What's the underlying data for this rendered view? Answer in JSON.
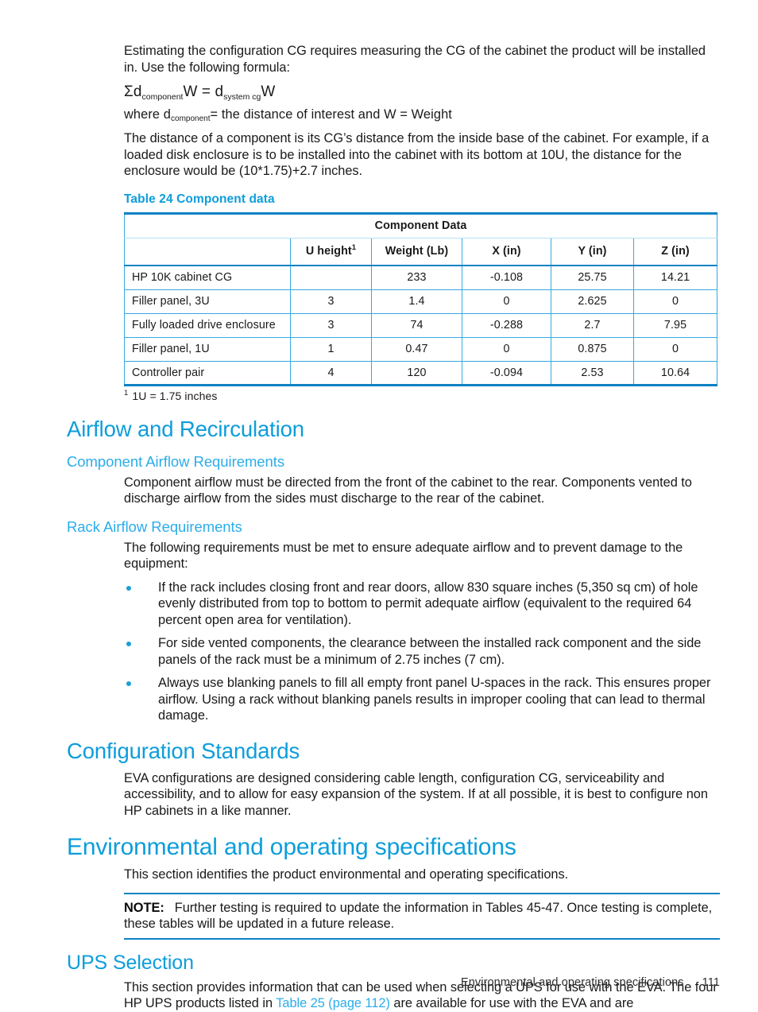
{
  "document": {
    "intro_paragraph": "Estimating the configuration CG requires measuring the CG of the cabinet the product will be installed in. Use the following formula:",
    "formula": {
      "sigma_d": "Σd",
      "sub_component": "component",
      "equals_part": "W = d",
      "sub_system_cg": "system cg",
      "tail_w": "W"
    },
    "where_line": {
      "prefix": "where d",
      "sub": "component",
      "suffix": "= the distance of interest and W = Weight"
    },
    "distance_paragraph": "The distance of a component is its CG’s distance from the inside base of the cabinet. For example, if a loaded disk enclosure is to be installed into the cabinet with its bottom at 10U, the distance for the enclosure would be (10*1.75)+2.7 inches."
  },
  "table24": {
    "caption": "Table 24 Component data",
    "title_row": "Component Data",
    "headers": [
      "",
      "U height",
      "Weight (Lb)",
      "X (in)",
      "Y (in)",
      "Z (in)"
    ],
    "header_superscript": "1",
    "rows": [
      {
        "label": "HP 10K cabinet CG",
        "u_height": "",
        "weight": "233",
        "x": "-0.108",
        "y": "25.75",
        "z": "14.21"
      },
      {
        "label": "Filler panel, 3U",
        "u_height": "3",
        "weight": "1.4",
        "x": "0",
        "y": "2.625",
        "z": "0"
      },
      {
        "label": "Fully loaded drive enclosure",
        "u_height": "3",
        "weight": "74",
        "x": "-0.288",
        "y": "2.7",
        "z": "7.95"
      },
      {
        "label": "Filler panel, 1U",
        "u_height": "1",
        "weight": "0.47",
        "x": "0",
        "y": "0.875",
        "z": "0"
      },
      {
        "label": "Controller pair",
        "u_height": "4",
        "weight": "120",
        "x": "-0.094",
        "y": "2.53",
        "z": "10.64"
      }
    ],
    "footnote_marker": "1",
    "footnote_text": "1U = 1.75 inches"
  },
  "airflow": {
    "heading": "Airflow and Recirculation",
    "component_airflow": {
      "heading": "Component Airflow Requirements",
      "paragraph": "Component airflow must be directed from the front of the cabinet to the rear. Components vented to discharge airflow from the sides must discharge to the rear of the cabinet."
    },
    "rack_airflow": {
      "heading": "Rack Airflow Requirements",
      "intro": "The following requirements must be met to ensure adequate airflow and to prevent damage to the equipment:",
      "bullets": [
        "If the rack includes closing front and rear doors, allow 830 square inches (5,350 sq cm) of hole evenly distributed from top to bottom to permit adequate airflow (equivalent to the required 64 percent open area for ventilation).",
        "For side vented components, the clearance between the installed rack component and the side panels of the rack must be a minimum of 2.75 inches (7 cm).",
        "Always use blanking panels to fill all empty front panel U-spaces in the rack. This ensures proper airflow. Using a rack without blanking panels results in improper cooling that can lead to thermal damage."
      ]
    }
  },
  "configuration_standards": {
    "heading": "Configuration Standards",
    "paragraph": "EVA configurations are designed considering cable length, configuration CG, serviceability and accessibility, and to allow for easy expansion of the system. If at all possible, it is best to configure non HP cabinets in a like manner."
  },
  "environmental": {
    "heading": "Environmental and operating specifications",
    "paragraph": "This section identifies the product environmental and operating specifications.",
    "note": {
      "label": "NOTE:",
      "text": "Further testing is required to update the information in Tables 45-47. Once testing is complete, these tables will be updated in a future release."
    }
  },
  "ups_selection": {
    "heading": "UPS Selection",
    "paragraph_before_link": "This section provides information that can be used when selecting a UPS for use with the EVA. The four HP UPS products listed in ",
    "link_text": "Table 25 (page 112)",
    "paragraph_after_link": " are available for use with the EVA and are"
  },
  "footer": {
    "section_title": "Environmental and operating specifications",
    "page_number": "111"
  },
  "colors": {
    "heading_blue": "#0d9ddb",
    "subheading_blue": "#2badea",
    "table_border_dark": "#0b82c4",
    "table_border_light": "#36a9e0",
    "bullet_blue": "#1b9fd8",
    "text": "#1a1a1a"
  }
}
